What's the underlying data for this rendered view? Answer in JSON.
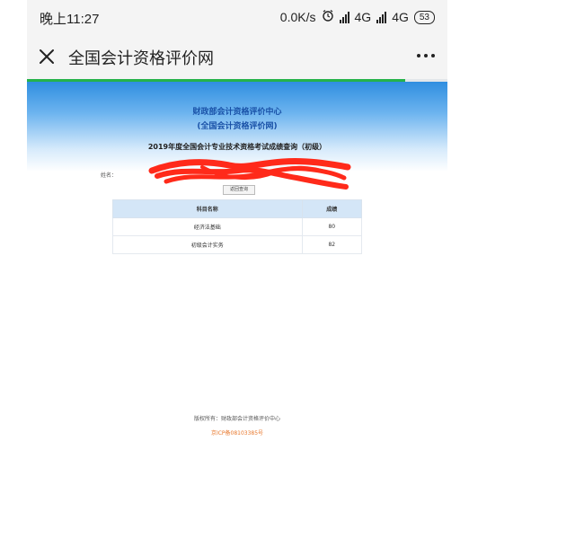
{
  "status_bar": {
    "time": "晚上11:27",
    "net_speed": "0.0K/s",
    "network_1": "4G",
    "network_2": "4G",
    "battery": "53"
  },
  "nav": {
    "title": "全国会计资格评价网"
  },
  "page_load": {
    "progress_fraction": 0.9
  },
  "page": {
    "center_line1": "财政部会计资格评价中心",
    "center_line2": "(全国会计资格评价网)",
    "exam_title": "2019年度全国会计专业技术资格考试成绩查询（初级）",
    "name_label": "姓名：",
    "return_button": "返回查询",
    "table": {
      "headers": [
        "科目名称",
        "成绩"
      ],
      "rows": [
        {
          "subject": "经济法基础",
          "score": "80"
        },
        {
          "subject": "初级会计实务",
          "score": "82"
        }
      ]
    },
    "footer_copyright": "版权所有：财政部会计资格评价中心",
    "footer_icp": "京ICP备08103385号"
  },
  "colors": {
    "accent_green": "#25b24a",
    "title_blue": "#1a52a8",
    "table_header": "#d4e6f7",
    "footer_link": "#e8772b",
    "redaction": "#ff2a1a"
  }
}
